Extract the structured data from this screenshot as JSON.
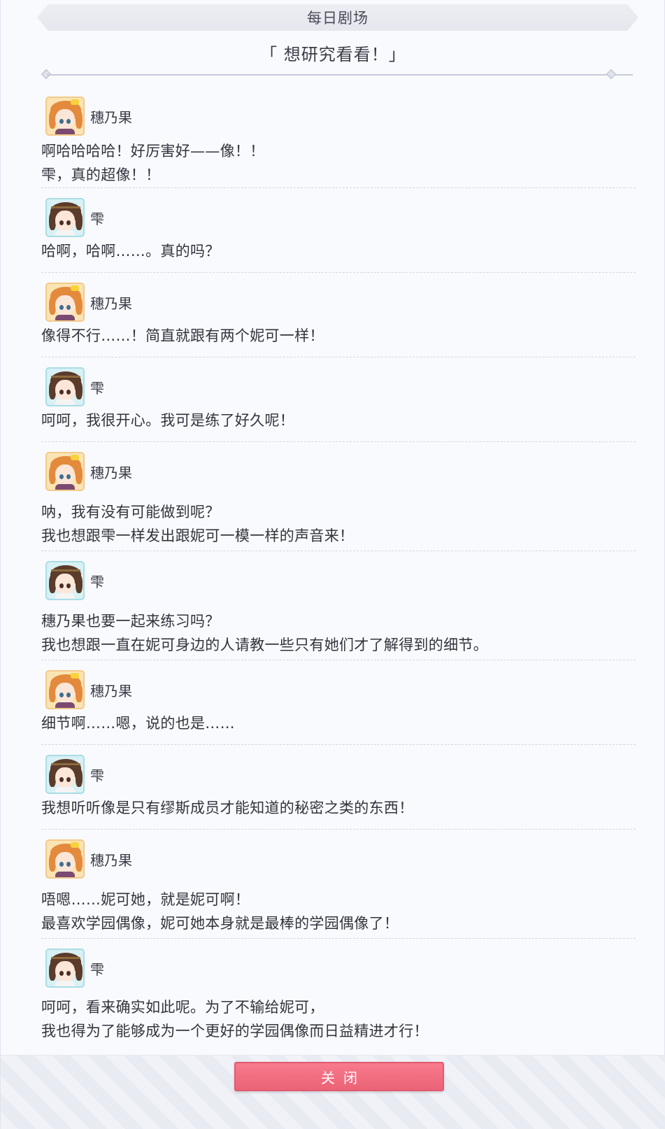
{
  "header": {
    "title": "每日剧场"
  },
  "episode": {
    "title": "「 想研究看看！」"
  },
  "dialogue": [
    {
      "speaker": "穗乃果",
      "avatar": "honoka-avatar",
      "lines": [
        "啊哈哈哈哈！好厉害好——像！！",
        "雫，真的超像！！"
      ]
    },
    {
      "speaker": "雫",
      "avatar": "shizuku-avatar",
      "lines": [
        "哈啊，哈啊……。真的吗？"
      ]
    },
    {
      "speaker": "穗乃果",
      "avatar": "honoka-avatar",
      "lines": [
        "像得不行……！简直就跟有两个妮可一样！"
      ]
    },
    {
      "speaker": "雫",
      "avatar": "shizuku-avatar",
      "lines": [
        "呵呵，我很开心。我可是练了好久呢！"
      ]
    },
    {
      "speaker": "穗乃果",
      "avatar": "honoka-avatar",
      "lines": [
        "呐，我有没有可能做到呢？",
        "我也想跟雫一样发出跟妮可一模一样的声音来！"
      ]
    },
    {
      "speaker": "雫",
      "avatar": "shizuku-avatar",
      "lines": [
        "穗乃果也要一起来练习吗？",
        "我也想跟一直在妮可身边的人请教一些只有她们才了解得到的细节。"
      ]
    },
    {
      "speaker": "穗乃果",
      "avatar": "honoka-avatar",
      "lines": [
        "细节啊……嗯，说的也是……"
      ]
    },
    {
      "speaker": "雫",
      "avatar": "shizuku-avatar",
      "lines": [
        "我想听听像是只有缪斯成员才能知道的秘密之类的东西！"
      ]
    },
    {
      "speaker": "穗乃果",
      "avatar": "honoka-avatar",
      "lines": [
        "唔嗯……妮可她，就是妮可啊！",
        "最喜欢学园偶像，妮可她本身就是最棒的学园偶像了！"
      ]
    },
    {
      "speaker": "雫",
      "avatar": "shizuku-avatar",
      "lines": [
        "呵呵，看来确实如此呢。为了不输给妮可，",
        "我也得为了能够成为一个更好的学园偶像而日益精进才行！"
      ]
    }
  ],
  "footer": {
    "close_label": "关闭"
  },
  "colors": {
    "close_button": "#ec6277",
    "honoka_frame": "#f3c98a",
    "shizuku_frame": "#a9dde6"
  }
}
